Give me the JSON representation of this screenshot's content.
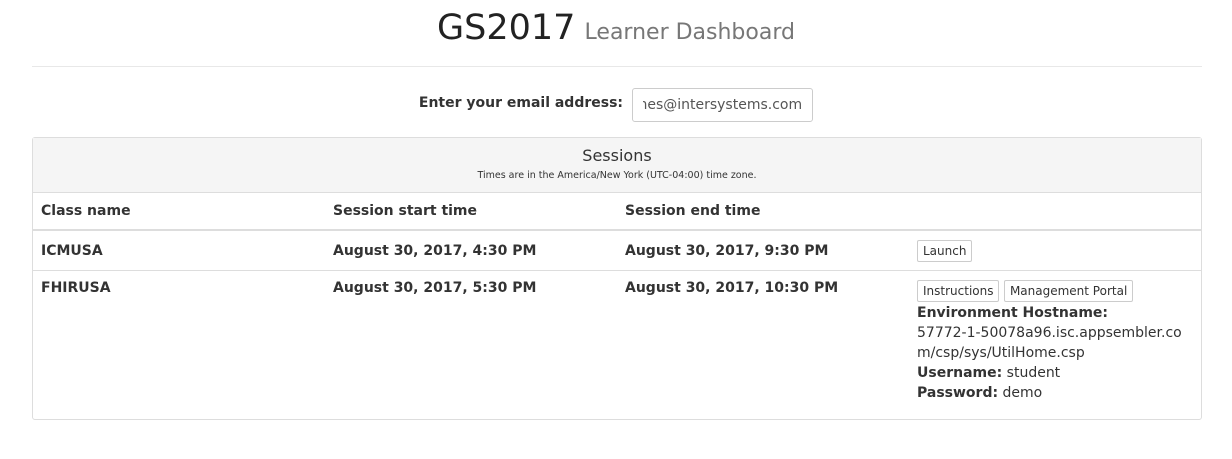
{
  "header": {
    "app_name": "GS2017",
    "subtitle": "Learner Dashboard"
  },
  "email": {
    "label": "Enter your email address:",
    "value": "james@intersystems.com"
  },
  "sessions": {
    "title": "Sessions",
    "note": "Times are in the America/New York (UTC-04:00) time zone.",
    "columns": [
      "Class name",
      "Session start time",
      "Session end time",
      ""
    ],
    "rows": [
      {
        "class_name": "ICMUSA",
        "start": "August 30, 2017, 4:30 PM",
        "end": "August 30, 2017, 9:30 PM",
        "launch_label": "Launch"
      },
      {
        "class_name": "FHIRUSA",
        "start": "August 30, 2017, 5:30 PM",
        "end": "August 30, 2017, 10:30 PM",
        "instructions_label": "Instructions",
        "portal_label": "Management Portal",
        "env_hostname_label": "Environment Hostname:",
        "env_hostname_value": "57772-1-50078a96.isc.appsembler.com/csp/sys/UtilHome.csp",
        "username_label": "Username:",
        "username_value": "student",
        "password_label": "Password:",
        "password_value": "demo"
      }
    ]
  }
}
